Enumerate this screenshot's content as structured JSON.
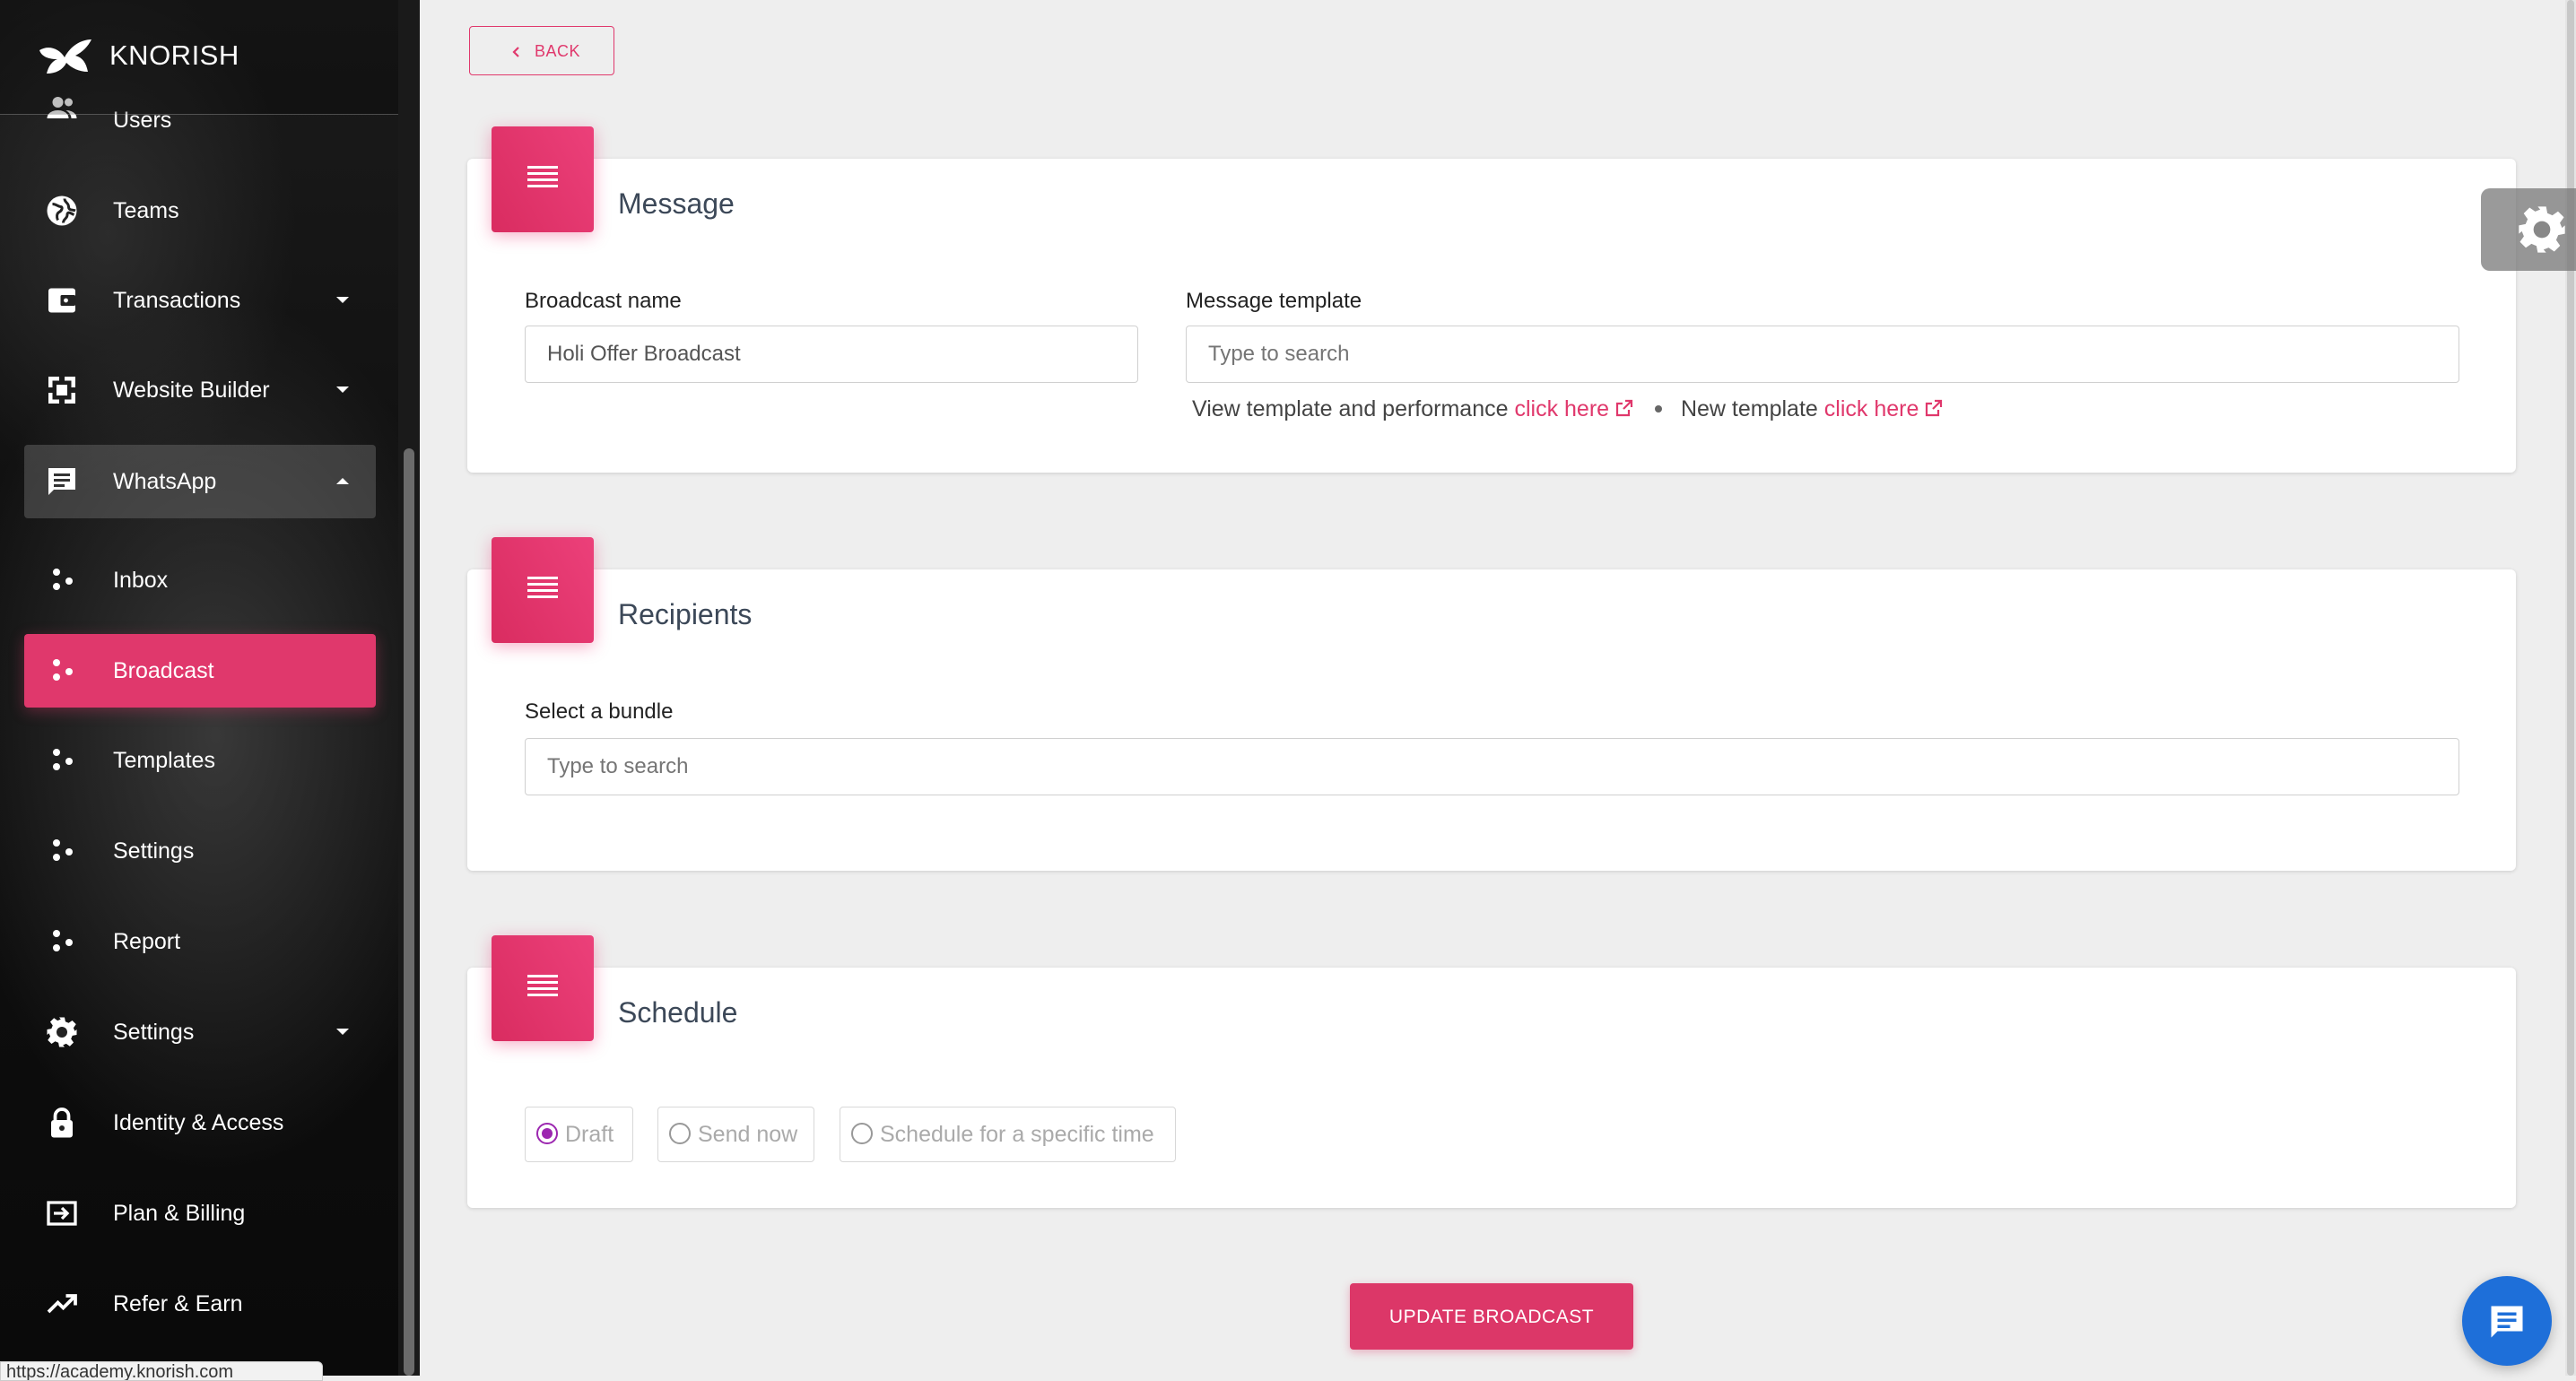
{
  "brand": {
    "name": "KNORISH"
  },
  "sidebar": {
    "items": [
      {
        "label": "Users",
        "icon": "users-icon"
      },
      {
        "label": "Teams",
        "icon": "globe-icon"
      },
      {
        "label": "Transactions",
        "icon": "wallet-icon",
        "has_caret": true
      },
      {
        "label": "Website Builder",
        "icon": "website-builder-icon",
        "has_caret": true
      },
      {
        "label": "WhatsApp",
        "icon": "chat-icon",
        "expanded": true
      },
      {
        "label": "Inbox",
        "icon": "dots-icon"
      },
      {
        "label": "Broadcast",
        "icon": "dots-icon",
        "active": true
      },
      {
        "label": "Templates",
        "icon": "dots-icon"
      },
      {
        "label": "Settings",
        "icon": "dots-icon"
      },
      {
        "label": "Report",
        "icon": "dots-icon"
      },
      {
        "label": "Settings",
        "icon": "gear-icon",
        "has_caret": true
      },
      {
        "label": "Identity & Access",
        "icon": "lock-icon"
      },
      {
        "label": "Plan & Billing",
        "icon": "billing-icon"
      },
      {
        "label": "Refer & Earn",
        "icon": "trending-up-icon"
      }
    ]
  },
  "status_bar_url": "https://academy.knorish.com",
  "back_label": "BACK",
  "message_card": {
    "title": "Message",
    "broadcast_name_label": "Broadcast name",
    "broadcast_name_value": "Holi Offer Broadcast",
    "template_label": "Message template",
    "template_placeholder": "Type to search",
    "view_template_text": "View template and performance",
    "view_template_link": "click here",
    "new_template_text": "New template",
    "new_template_link": "click here"
  },
  "recipients_card": {
    "title": "Recipients",
    "bundle_label": "Select a bundle",
    "bundle_placeholder": "Type to search"
  },
  "schedule_card": {
    "title": "Schedule",
    "options": [
      {
        "label": "Draft",
        "selected": true
      },
      {
        "label": "Send now",
        "selected": false
      },
      {
        "label": "Schedule for a specific time",
        "selected": false
      }
    ]
  },
  "update_button_label": "UPDATE BROADCAST",
  "colors": {
    "accent": "#e0386c",
    "radio_selected": "#9c27b0",
    "chat_fab": "#1e6fd9"
  }
}
